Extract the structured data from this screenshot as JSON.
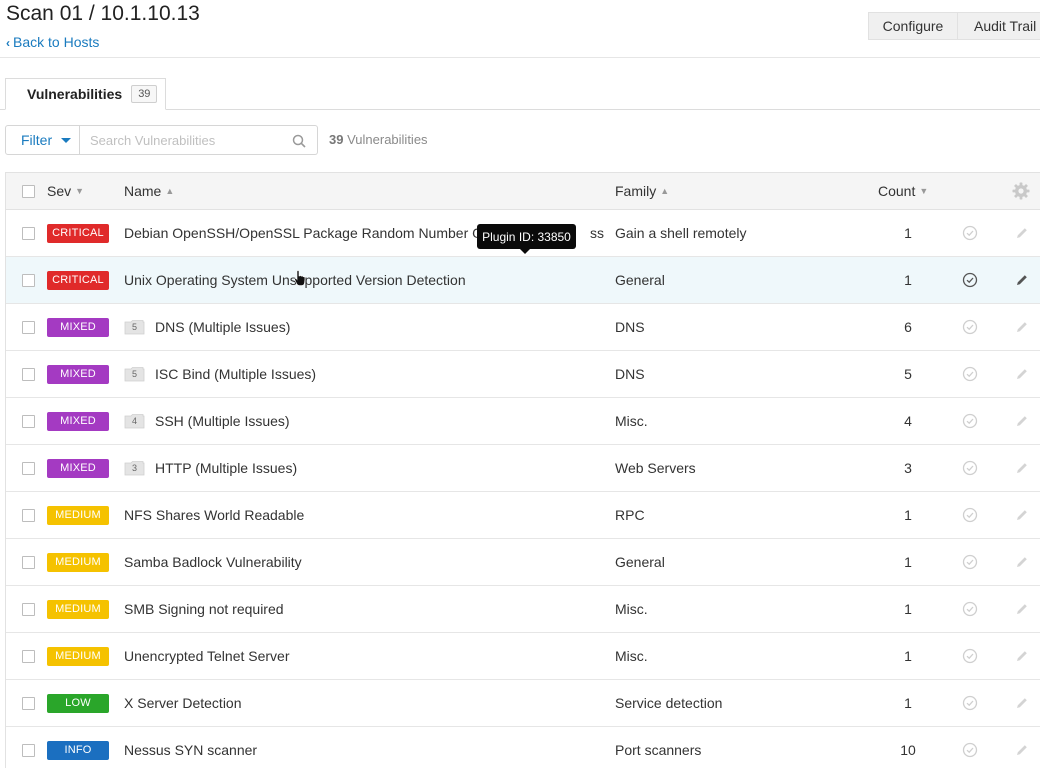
{
  "header": {
    "title": "Scan 01 / 10.1.10.13",
    "back_label": "Back to Hosts",
    "configure_label": "Configure",
    "audit_trail_label": "Audit Trail"
  },
  "tabs": [
    {
      "label": "Vulnerabilities",
      "count": "39"
    }
  ],
  "toolbar": {
    "filter_label": "Filter",
    "search_placeholder": "Search Vulnerabilities",
    "count_number": "39",
    "count_label": "Vulnerabilities"
  },
  "table": {
    "columns": {
      "sev": "Sev",
      "name": "Name",
      "family": "Family",
      "count": "Count"
    },
    "rows": [
      {
        "sev": "CRITICAL",
        "sev_class": "critical",
        "name": "Debian OpenSSH/OpenSSL Package Random Number Ge",
        "name_tail": "ss",
        "family": "Gain a shell remotely",
        "count": "1",
        "folder": ""
      },
      {
        "sev": "CRITICAL",
        "sev_class": "critical",
        "name": "Unix Operating System Unsupported Version Detection",
        "family": "General",
        "count": "1",
        "folder": ""
      },
      {
        "sev": "MIXED",
        "sev_class": "mixed",
        "name": "DNS (Multiple Issues)",
        "family": "DNS",
        "count": "6",
        "folder": "5"
      },
      {
        "sev": "MIXED",
        "sev_class": "mixed",
        "name": "ISC Bind (Multiple Issues)",
        "family": "DNS",
        "count": "5",
        "folder": "5"
      },
      {
        "sev": "MIXED",
        "sev_class": "mixed",
        "name": "SSH (Multiple Issues)",
        "family": "Misc.",
        "count": "4",
        "folder": "4"
      },
      {
        "sev": "MIXED",
        "sev_class": "mixed",
        "name": "HTTP (Multiple Issues)",
        "family": "Web Servers",
        "count": "3",
        "folder": "3"
      },
      {
        "sev": "MEDIUM",
        "sev_class": "medium",
        "name": "NFS Shares World Readable",
        "family": "RPC",
        "count": "1",
        "folder": ""
      },
      {
        "sev": "MEDIUM",
        "sev_class": "medium",
        "name": "Samba Badlock Vulnerability",
        "family": "General",
        "count": "1",
        "folder": ""
      },
      {
        "sev": "MEDIUM",
        "sev_class": "medium",
        "name": "SMB Signing not required",
        "family": "Misc.",
        "count": "1",
        "folder": ""
      },
      {
        "sev": "MEDIUM",
        "sev_class": "medium",
        "name": "Unencrypted Telnet Server",
        "family": "Misc.",
        "count": "1",
        "folder": ""
      },
      {
        "sev": "LOW",
        "sev_class": "low",
        "name": "X Server Detection",
        "family": "Service detection",
        "count": "1",
        "folder": ""
      },
      {
        "sev": "INFO",
        "sev_class": "info",
        "name": "Nessus SYN scanner",
        "family": "Port scanners",
        "count": "10",
        "folder": ""
      }
    ]
  },
  "tooltip": {
    "text": "Plugin ID: 33850"
  },
  "colors": {
    "critical": "#e02a2a",
    "mixed": "#a43ac2",
    "medium": "#f5c200",
    "low": "#2aa62a",
    "info": "#1b6fc0",
    "link": "#1a7bbf",
    "row_hover": "#eff8fb"
  },
  "icons": {
    "back": "chevron-left-icon",
    "search": "search-icon",
    "settings": "gear-icon",
    "row_check": "check-circle-icon",
    "row_edit": "pencil-icon",
    "group": "folder-icon"
  }
}
